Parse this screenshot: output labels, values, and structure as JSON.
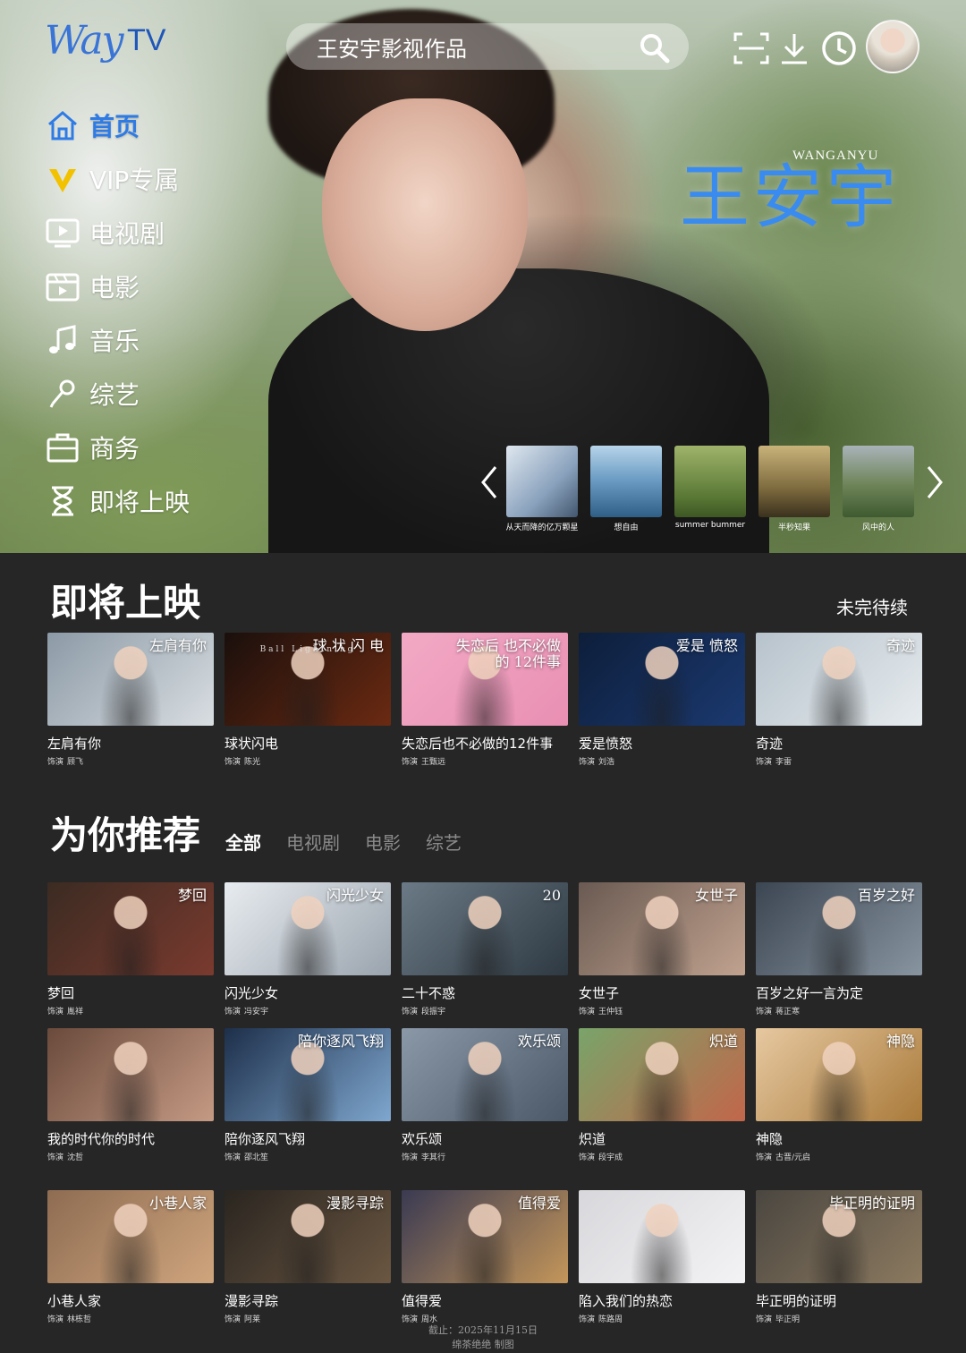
{
  "brand": {
    "logo_way": "Way",
    "logo_tv": "TV"
  },
  "search": {
    "query": "王安宇影视作品"
  },
  "topbar": {
    "icons": [
      "scan-icon",
      "download-icon",
      "history-icon"
    ]
  },
  "nav": {
    "items": [
      {
        "label": "首页",
        "icon": "home-icon",
        "active": true
      },
      {
        "label": "VIP专属",
        "icon": "vip-icon"
      },
      {
        "label": "电视剧",
        "icon": "tv-icon"
      },
      {
        "label": "电影",
        "icon": "film-icon"
      },
      {
        "label": "音乐",
        "icon": "music-icon"
      },
      {
        "label": "综艺",
        "icon": "mic-icon"
      },
      {
        "label": "商务",
        "icon": "briefcase-icon"
      },
      {
        "label": "即将上映",
        "icon": "hourglass-icon"
      }
    ]
  },
  "hero": {
    "name_cn": "王安宇",
    "name_en": "WANGANYU",
    "carousel": [
      {
        "caption": "从天而降的亿万颗星"
      },
      {
        "caption": "想自由"
      },
      {
        "caption": "summer bummer"
      },
      {
        "caption": "半秒知果"
      },
      {
        "caption": "风中的人"
      }
    ]
  },
  "upcoming": {
    "title": "即将上映",
    "more": "未完待续",
    "items": [
      {
        "title": "左肩有你",
        "role": "饰演",
        "char": "顾飞",
        "overlay": "左肩有你",
        "c1": "#8c9aa6",
        "c2": "#d9dee2"
      },
      {
        "title": "球状闪电",
        "role": "饰演",
        "char": "陈光",
        "overlay": "球 状 闪 电",
        "overlay_sub": "Ball Lightning",
        "c1": "#1a0f0c",
        "c2": "#6b2a12"
      },
      {
        "title": "失恋后也不必做的12件事",
        "role": "饰演",
        "char": "王甄远",
        "overlay": "失恋后 也不必做的 12件事",
        "c1": "#f2a9c4",
        "c2": "#e98fb3"
      },
      {
        "title": "爱是愤怒",
        "role": "饰演",
        "char": "刘浩",
        "overlay": "爱是 愤怒",
        "c1": "#0d1e3a",
        "c2": "#1b3970"
      },
      {
        "title": "奇迹",
        "role": "饰演",
        "char": "李雷",
        "overlay": "奇迹",
        "c1": "#b7c3cc",
        "c2": "#e6ebee"
      }
    ]
  },
  "recommend": {
    "title": "为你推荐",
    "tabs": [
      {
        "label": "全部",
        "active": true
      },
      {
        "label": "电视剧"
      },
      {
        "label": "电影"
      },
      {
        "label": "综艺"
      }
    ],
    "rows": [
      [
        {
          "title": "梦回",
          "role": "饰演",
          "char": "胤祥",
          "overlay": "梦回",
          "c1": "#3b2b22",
          "c2": "#7a3a2f"
        },
        {
          "title": "闪光少女",
          "role": "饰演",
          "char": "冯安宇",
          "overlay": "闪光少女",
          "c1": "#e8ecf0",
          "c2": "#9aa4ae"
        },
        {
          "title": "二十不惑",
          "role": "饰演",
          "char": "段振宇",
          "overlay": "20",
          "c1": "#6b7a86",
          "c2": "#2e3942"
        },
        {
          "title": "女世子",
          "role": "饰演",
          "char": "王仲钰",
          "overlay": "女世子",
          "c1": "#6a5a52",
          "c2": "#c1a28f"
        },
        {
          "title": "百岁之好一言为定",
          "role": "饰演",
          "char": "蒋正寒",
          "overlay": "百岁之好",
          "c1": "#3b4652",
          "c2": "#8894a0"
        }
      ],
      [
        {
          "title": "我的时代你的时代",
          "role": "饰演",
          "char": "沈哲",
          "overlay": "",
          "c1": "#6a4a3c",
          "c2": "#c59a84"
        },
        {
          "title": "陪你逐风飞翔",
          "role": "饰演",
          "char": "邵北笙",
          "overlay": "陪你逐风飞翔",
          "c1": "#1d2f4a",
          "c2": "#7fa7cf"
        },
        {
          "title": "欢乐颂",
          "role": "饰演",
          "char": "李其行",
          "overlay": "欢乐颂",
          "c1": "#8a98a8",
          "c2": "#4a5868"
        },
        {
          "title": "炽道",
          "role": "饰演",
          "char": "段宇成",
          "overlay": "炽道",
          "c1": "#79a46a",
          "c2": "#c2664a"
        },
        {
          "title": "神隐",
          "role": "饰演",
          "char": "古晋/元启",
          "overlay": "神隐",
          "c1": "#e6c8a0",
          "c2": "#a97a3a"
        }
      ],
      [
        {
          "title": "小巷人家",
          "role": "饰演",
          "char": "林栋哲",
          "overlay": "小巷人家",
          "c1": "#8e6c52",
          "c2": "#cfa57d"
        },
        {
          "title": "漫影寻踪",
          "role": "饰演",
          "char": "阿莱",
          "overlay": "漫影寻踪",
          "c1": "#2a2520",
          "c2": "#6b5742"
        },
        {
          "title": "值得爱",
          "role": "饰演",
          "char": "周水",
          "overlay": "值得爱",
          "c1": "#3a3a52",
          "c2": "#c4965a"
        },
        {
          "title": "陷入我们的热恋",
          "role": "饰演",
          "char": "陈路周",
          "overlay": "",
          "c1": "#d8d8dc",
          "c2": "#f3f3f5"
        },
        {
          "title": "毕正明的证明",
          "role": "饰演",
          "char": "毕正明",
          "overlay": "毕正明的证明",
          "c1": "#4a4640",
          "c2": "#8c7a60"
        }
      ]
    ]
  },
  "footer": {
    "line1": "截止：2025年11月15日",
    "line2": "绵茶绝绝  制图"
  }
}
